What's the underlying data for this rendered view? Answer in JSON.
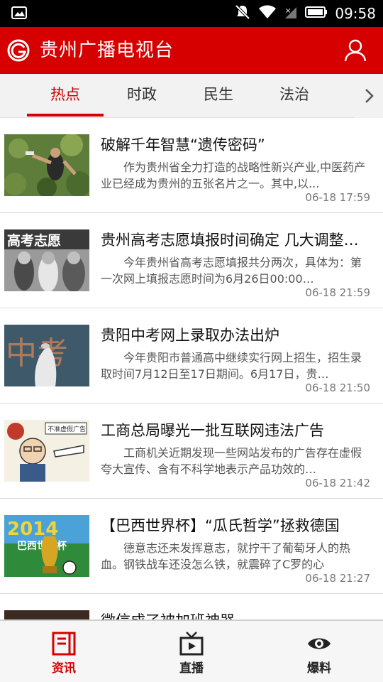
{
  "status_bar": {
    "time": "09:58",
    "icons": [
      "image-icon",
      "mute-icon",
      "wifi-icon",
      "signal-icon",
      "battery-icon"
    ]
  },
  "app_bar": {
    "title": "贵州广播电视台",
    "logo_icon": "g-logo-icon",
    "user_icon": "user-icon"
  },
  "tabs": [
    {
      "label": "热点",
      "active": true
    },
    {
      "label": "时政",
      "active": false
    },
    {
      "label": "民生",
      "active": false
    },
    {
      "label": "法治",
      "active": false
    }
  ],
  "tab_more_icon": "chevron-right-icon",
  "news": [
    {
      "title": "破解千年智慧“遗传密码”",
      "summary": "作为贵州省全力打造的战略性新兴产业,中医药产业已经成为贵州的五张名片之一。其中,以...",
      "time": "06-18 17:59"
    },
    {
      "title": "贵州高考志愿填报时间确定 几大调整…",
      "summary": "今年贵州省高考志愿填报共分两次，具体为：第一次网上填报志愿时间为6月26日00:00…",
      "time": "06-18 21:59",
      "thumb_text": "高考志愿"
    },
    {
      "title": "贵阳中考网上录取办法出炉",
      "summary": "今年贵阳市普通高中继续实行网上招生，招生录取时间7月12日至17日期间。6月17日，贵…",
      "time": "06-18 21:50",
      "thumb_text": "中考"
    },
    {
      "title": "工商总局曝光一批互联网违法广告",
      "summary": "工商机关近期发现一些网站发布的广告存在虚假夸大宣传、含有不科学地表示产品功效的…",
      "time": "06-18 21:42",
      "thumb_text": "不准虚假广告"
    },
    {
      "title": "【巴西世界杯】“瓜氏哲学”拯救德国",
      "summary": "德意志还未发挥意志，就拧干了葡萄牙人的热血。钢铁战车还没怎么铁，就震碎了C罗的心",
      "time": "06-18 21:27",
      "thumb_text": "巴西世界杯",
      "thumb_year": "2014"
    },
    {
      "title": "微信成了被加班神器",
      "summary": "",
      "time": ""
    }
  ],
  "bottom_nav": [
    {
      "label": "资讯",
      "icon": "news-icon",
      "active": true
    },
    {
      "label": "直播",
      "icon": "tv-icon",
      "active": false
    },
    {
      "label": "爆料",
      "icon": "eye-icon",
      "active": false
    }
  ],
  "colors": {
    "brand_red": "#d60000",
    "tab_bg": "#f2f2f2",
    "text_primary": "#111111",
    "text_secondary": "#555555"
  }
}
